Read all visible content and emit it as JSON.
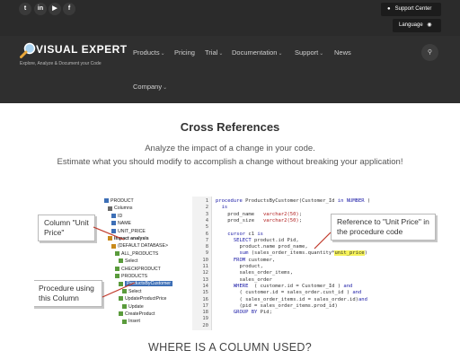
{
  "topbar": {
    "social_icons": [
      {
        "name": "twitter-icon",
        "glyph": "t"
      },
      {
        "name": "linkedin-icon",
        "glyph": "in"
      },
      {
        "name": "youtube-icon",
        "glyph": "▶"
      },
      {
        "name": "facebook-icon",
        "glyph": "f"
      }
    ],
    "support_label": "Support Center",
    "language_label": "Language"
  },
  "header": {
    "logo_text": "VISUAL EXPERT",
    "tagline": "Explore, Analyze & Document your Code",
    "nav": {
      "products": "Products",
      "pricing": "Pricing",
      "trial": "Trial",
      "documentation": "Documentation",
      "support": "Support",
      "news": "News",
      "company": "Company"
    }
  },
  "main": {
    "title": "Cross References",
    "intro_line1": "Analyze the impact of a change in your code.",
    "intro_line2": "Estimate what you should modify to accomplish a change without breaking your application!",
    "section_heading": "WHERE IS A COLUMN USED?"
  },
  "screenshot": {
    "callout_column": "Column \"Unit Price\"",
    "callout_procedure": "Procedure using this Column",
    "callout_reference": "Reference to \"Unit Price\" in the procedure code",
    "tree": [
      "PRODUCT",
      "Columns",
      "ID",
      "NAME",
      "UNIT_PRICE",
      "Impact analysis",
      "(DEFAULT DATABASE>",
      "ALL_PRODUCTS",
      "Select",
      "CHECKPRODUCT",
      "PRODUCTS",
      "ProductsByCustomer",
      "Select",
      "UpdateProductPrice",
      "Update",
      "CreateProduct",
      "Insert"
    ],
    "code_lines": [
      {
        "n": "1",
        "t": "procedure ProductsByCustomer(Customer_Id in NUMBER )"
      },
      {
        "n": "2",
        "t": "  is"
      },
      {
        "n": "3",
        "t": "    prod_name   varchar2(50);"
      },
      {
        "n": "4",
        "t": "    prod_size   varchar2(50);"
      },
      {
        "n": "5",
        "t": ""
      },
      {
        "n": "6",
        "t": "    cursor c1 is"
      },
      {
        "n": "7",
        "t": "      SELECT product.id Pid,"
      },
      {
        "n": "8",
        "t": "        product.name prod_name,"
      },
      {
        "n": "9",
        "t": "        sum (sales_order_items.quantity*unit_price)"
      },
      {
        "n": "10",
        "t": "      FROM customer,"
      },
      {
        "n": "11",
        "t": "        product,"
      },
      {
        "n": "12",
        "t": "        sales_order_items,"
      },
      {
        "n": "13",
        "t": "        sales_order"
      },
      {
        "n": "14",
        "t": "      WHERE  ( customer.id = Customer_Id ) and"
      },
      {
        "n": "15",
        "t": "        ( customer.id = sales_order.cust_id ) and"
      },
      {
        "n": "16",
        "t": "        ( sales_order_items.id = sales_order.id)and"
      },
      {
        "n": "17",
        "t": "        (pid = sales_order_items.prod_id)"
      },
      {
        "n": "18",
        "t": "      GROUP BY Pid;"
      },
      {
        "n": "19",
        "t": ""
      },
      {
        "n": "20",
        "t": ""
      }
    ]
  },
  "colors": {
    "topbar_bg": "#2b2b2b",
    "header_bg": "#2f2f2f",
    "highlight": "#f6f35a"
  }
}
